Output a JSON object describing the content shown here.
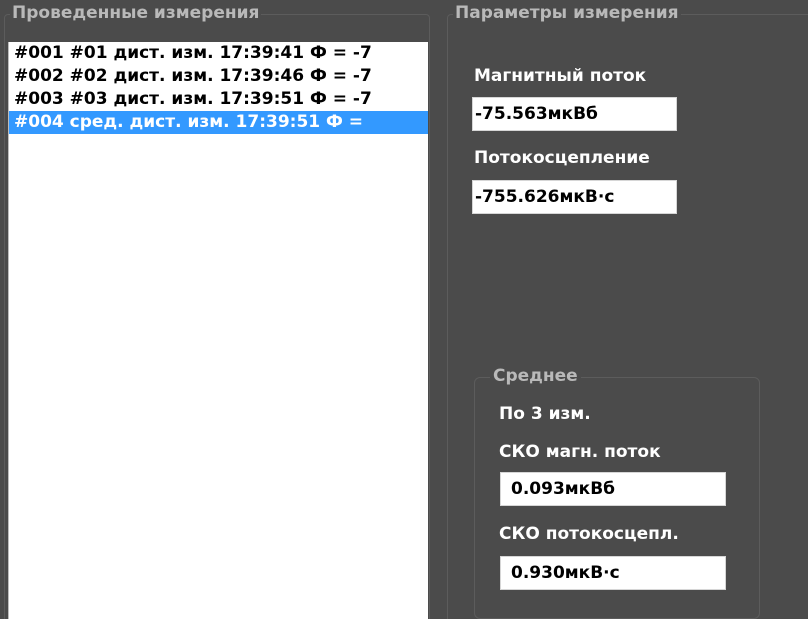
{
  "measurements_panel": {
    "title": "Проведенные измерения",
    "items": [
      {
        "label": "#001 #01 дист. изм. 17:39:41 Ф = -7",
        "selected": false
      },
      {
        "label": "#002 #02 дист. изм. 17:39:46 Ф = -7",
        "selected": false
      },
      {
        "label": "#003 #03 дист. изм. 17:39:51 Ф = -7",
        "selected": false
      },
      {
        "label": "#004 сред. дист. изм. 17:39:51 Ф = ",
        "selected": true
      }
    ]
  },
  "params_panel": {
    "title": "Параметры измерения",
    "magnetic_flux_label": "Магнитный поток",
    "magnetic_flux_value": "-75.563мкВб",
    "flux_linkage_label": "Потокосцепление",
    "flux_linkage_value": "-755.626мкВ·с",
    "average": {
      "title": "Среднее",
      "count_text": "По 3 изм.",
      "sko_flux_label": "СКО магн. поток",
      "sko_flux_value": "0.093мкВб",
      "sko_linkage_label": "СКО потокосцепл.",
      "sko_linkage_value": "0.930мкВ·с"
    }
  },
  "colors": {
    "background": "#4b4b4b",
    "selection": "#3399ff",
    "group_title": "#b9b9b9"
  }
}
